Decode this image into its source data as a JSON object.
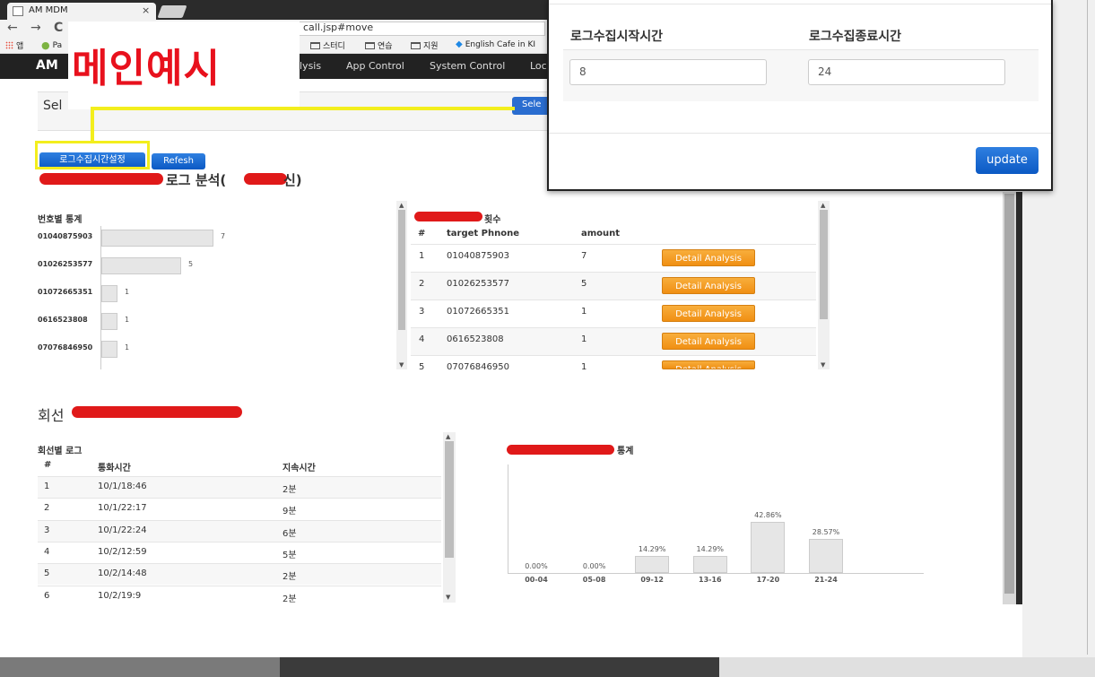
{
  "browser": {
    "tab_title": "AM MDM",
    "tab_close": "×",
    "url_text": "call.jsp#move",
    "bookmarks": {
      "apps": "앱",
      "pa": "Pa",
      "study": "스터디",
      "practice": "연습",
      "apply": "지원",
      "english": "English Cafe in KI"
    }
  },
  "navbar": {
    "brand": "AM",
    "links": [
      "lysis",
      "App Control",
      "System Control",
      "Loc"
    ]
  },
  "overlay_label": "메인예시",
  "select_panel": {
    "text": "Sel",
    "button": "Sele"
  },
  "buttons": {
    "log_time": "로그수집시간설정",
    "refresh": "Refesh"
  },
  "section1_title": {
    "visible": "로그 분석(",
    "suffix": "신)"
  },
  "number_stats": {
    "title": "번호별 통계",
    "chart_data": {
      "type": "bar",
      "categories": [
        "01040875903",
        "01026253577",
        "01072665351",
        "0616523808",
        "07076846950"
      ],
      "values": [
        7,
        5,
        1,
        1,
        1
      ]
    }
  },
  "count_table": {
    "title_suffix": "횟수",
    "headers": [
      "#",
      "target Phnone",
      "amount",
      ""
    ],
    "rows": [
      {
        "no": "1",
        "phone": "01040875903",
        "amount": "7",
        "button": "Detail Analysis"
      },
      {
        "no": "2",
        "phone": "01026253577",
        "amount": "5",
        "button": "Detail Analysis"
      },
      {
        "no": "3",
        "phone": "01072665351",
        "amount": "1",
        "button": "Detail Analysis"
      },
      {
        "no": "4",
        "phone": "0616523808",
        "amount": "1",
        "button": "Detail Analysis"
      },
      {
        "no": "5",
        "phone": "07076846950",
        "amount": "1",
        "button": "Detail Analysis"
      }
    ]
  },
  "section2_title": {
    "prefix": "회선"
  },
  "call_log": {
    "title": "회선별 로그",
    "headers": [
      "#",
      "통화시간",
      "지속시간"
    ],
    "rows": [
      {
        "no": "1",
        "time": "10/1/18:46",
        "duration": "2분"
      },
      {
        "no": "2",
        "time": "10/1/22:17",
        "duration": "9분"
      },
      {
        "no": "3",
        "time": "10/1/22:24",
        "duration": "6분"
      },
      {
        "no": "4",
        "time": "10/2/12:59",
        "duration": "5분"
      },
      {
        "no": "5",
        "time": "10/2/14:48",
        "duration": "2분"
      },
      {
        "no": "6",
        "time": "10/2/19:9",
        "duration": "2분"
      }
    ]
  },
  "time_stats": {
    "title_suffix": "통계",
    "chart_data": {
      "type": "bar",
      "categories": [
        "00-04",
        "05-08",
        "09-12",
        "13-16",
        "17-20",
        "21-24"
      ],
      "values": [
        0.0,
        0.0,
        14.29,
        14.29,
        42.86,
        28.57
      ],
      "labels": [
        "0.00%",
        "0.00%",
        "14.29%",
        "14.29%",
        "42.86%",
        "28.57%"
      ]
    }
  },
  "modal": {
    "start_label": "로그수집시작시간",
    "end_label": "로그수집종료시간",
    "start_value": "8",
    "end_value": "24",
    "update_button": "update"
  },
  "colors": {
    "accent_blue": "#0b59c4",
    "detail_orange": "#f08f13",
    "highlight_yellow": "#f3ee1d",
    "label_red": "#e8111d"
  }
}
